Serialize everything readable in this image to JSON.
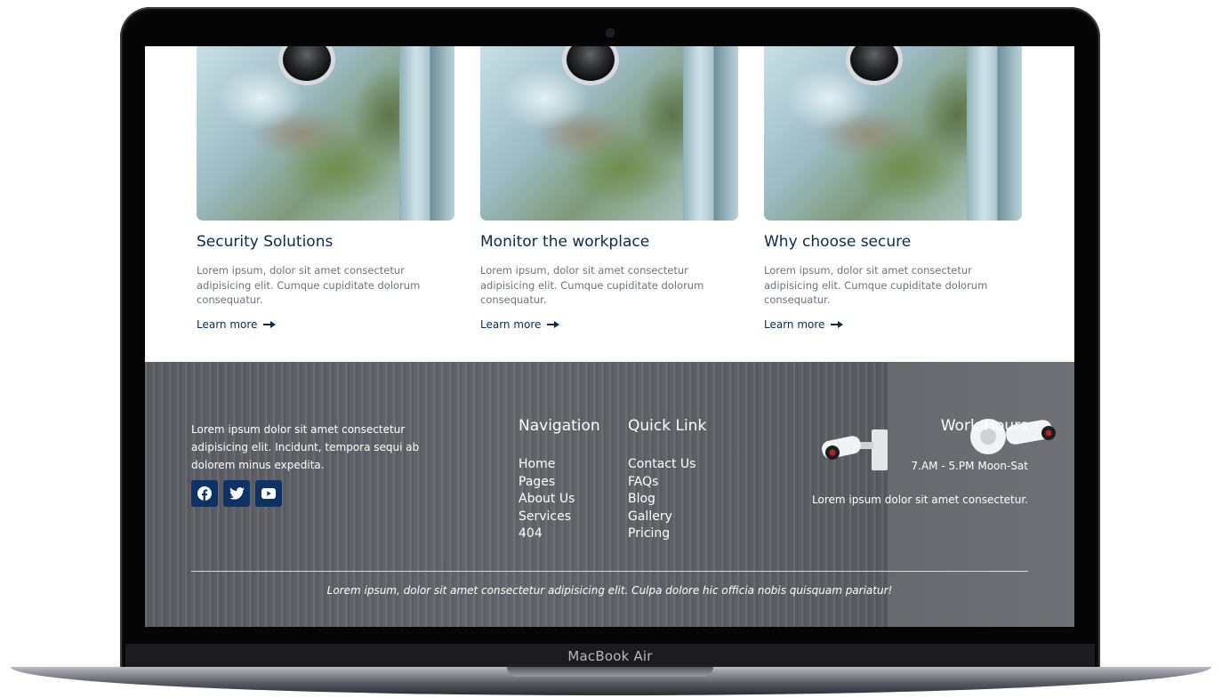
{
  "cards": [
    {
      "title": "Security Solutions",
      "text": "Lorem ipsum, dolor sit amet consectetur adipisicing elit. Cumque cupiditate dolorum consequatur.",
      "link": "Learn more"
    },
    {
      "title": "Monitor the workplace",
      "text": "Lorem ipsum, dolor sit amet consectetur adipisicing elit. Cumque cupiditate dolorum consequatur.",
      "link": "Learn more"
    },
    {
      "title": "Why choose secure",
      "text": "Lorem ipsum, dolor sit amet consectetur adipisicing elit. Cumque cupiditate dolorum consequatur.",
      "link": "Learn more"
    }
  ],
  "footer": {
    "about": "Lorem ipsum dolor sit amet consectetur adipisicing elit. Incidunt, tempora sequi ab dolorem minus expedita.",
    "socials": [
      "facebook-icon",
      "twitter-icon",
      "youtube-icon"
    ],
    "navigation": {
      "heading": "Navigation",
      "items": [
        "Home",
        "Pages",
        "About Us",
        "Services",
        "404"
      ]
    },
    "quick_link": {
      "heading": "Quick Link",
      "items": [
        "Contact Us",
        "FAQs",
        "Blog",
        "Gallery",
        "Pricing"
      ]
    },
    "work_hours": {
      "heading": "Work Hours",
      "hours": "7.AM - 5.PM Moon-Sat",
      "note": "Lorem ipsum dolor sit amet consectetur."
    },
    "copyright": "Lorem ipsum, dolor sit amet consectetur adipisicing elit. Culpa dolore hic officia nobis quisquam pariatur!"
  },
  "device": {
    "label": "MacBook Air"
  },
  "colors": {
    "accent": "#0c3266",
    "heading": "#0e2a4a",
    "body_text": "#6b7280",
    "footer_bg": "#5e6166"
  }
}
